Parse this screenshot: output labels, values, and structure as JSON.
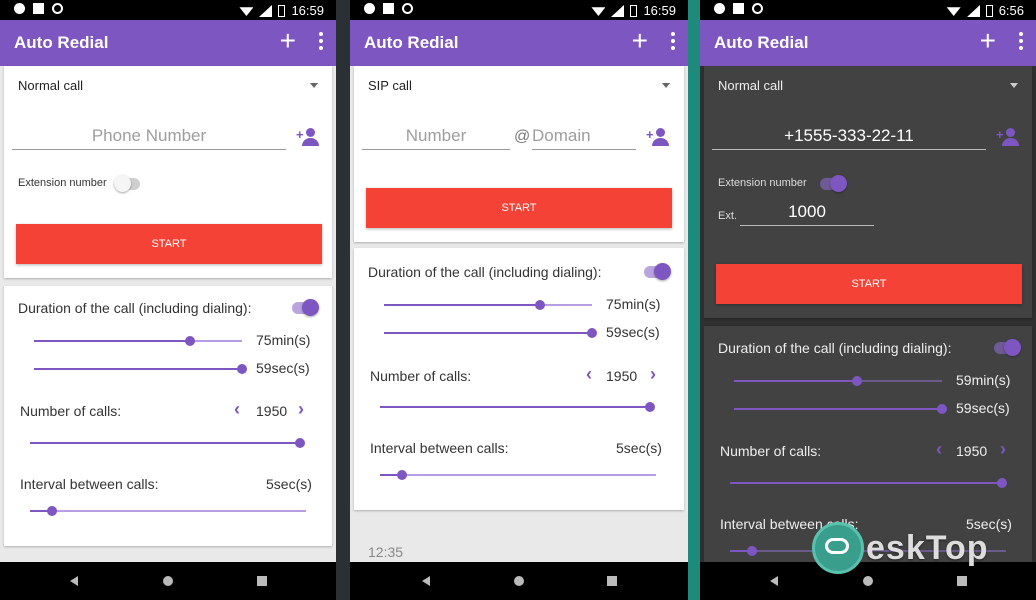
{
  "status": {
    "time1": "16:59",
    "time2": "16:59",
    "time3": "6:56"
  },
  "app": {
    "title": "Auto Redial"
  },
  "p1": {
    "call_type": "Normal call",
    "phone_placeholder": "Phone Number",
    "ext_label": "Extension number",
    "start": "START",
    "duration_label": "Duration of the call (including dialing):",
    "minutes": "75min(s)",
    "seconds": "59sec(s)",
    "calls_label": "Number of calls:",
    "calls_value": "1950",
    "interval_label": "Interval between calls:",
    "interval_value": "5sec(s)"
  },
  "p2": {
    "call_type": "SIP call",
    "number_placeholder": "Number",
    "at": "@",
    "domain_placeholder": "Domain",
    "start": "START",
    "duration_label": "Duration of the call (including dialing):",
    "minutes": "75min(s)",
    "seconds": "59sec(s)",
    "calls_label": "Number of calls:",
    "calls_value": "1950",
    "interval_label": "Interval between calls:",
    "interval_value": "5sec(s)",
    "footer_time": "12:35"
  },
  "p3": {
    "call_type": "Normal call",
    "phone_value": "+1555-333-22-11",
    "ext_label": "Extension number",
    "ext_short": "Ext.",
    "ext_value": "1000",
    "start": "START",
    "duration_label": "Duration of the call (including dialing):",
    "minutes": "59min(s)",
    "seconds": "59sec(s)",
    "calls_label": "Number of calls:",
    "calls_value": "1950",
    "interval_label": "Interval between calls:",
    "interval_value": "5sec(s)"
  },
  "sliders": {
    "p1_min": 0.75,
    "p1_sec": 1.0,
    "p1_calls": 1.0,
    "p1_interval": 0.08,
    "p2_min": 0.75,
    "p2_sec": 1.0,
    "p2_calls": 1.0,
    "p2_interval": 0.08,
    "p3_min": 0.59,
    "p3_sec": 1.0,
    "p3_calls": 1.0,
    "p3_interval": 0.08
  },
  "watermark": {
    "text": "eskTop"
  },
  "colors": {
    "accent": "#7e56c2",
    "button": "#f44336"
  }
}
